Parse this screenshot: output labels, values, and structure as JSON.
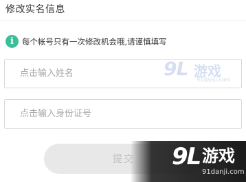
{
  "header": {
    "title": "修改实名信息"
  },
  "notice": {
    "icon": "info-icon",
    "icon_glyph": "i",
    "icon_color": "#3dbd9a",
    "text": "每个帐号只有一次修改机会哦,请谨慎填写"
  },
  "form": {
    "name_placeholder": "点击输入姓名",
    "name_value": "",
    "id_placeholder": "点击输入身份证号",
    "id_value": "",
    "submit_label": "提交"
  },
  "watermarks": {
    "brand_mark": "9L",
    "brand_cn": "游戏",
    "url": "91danji.com"
  }
}
